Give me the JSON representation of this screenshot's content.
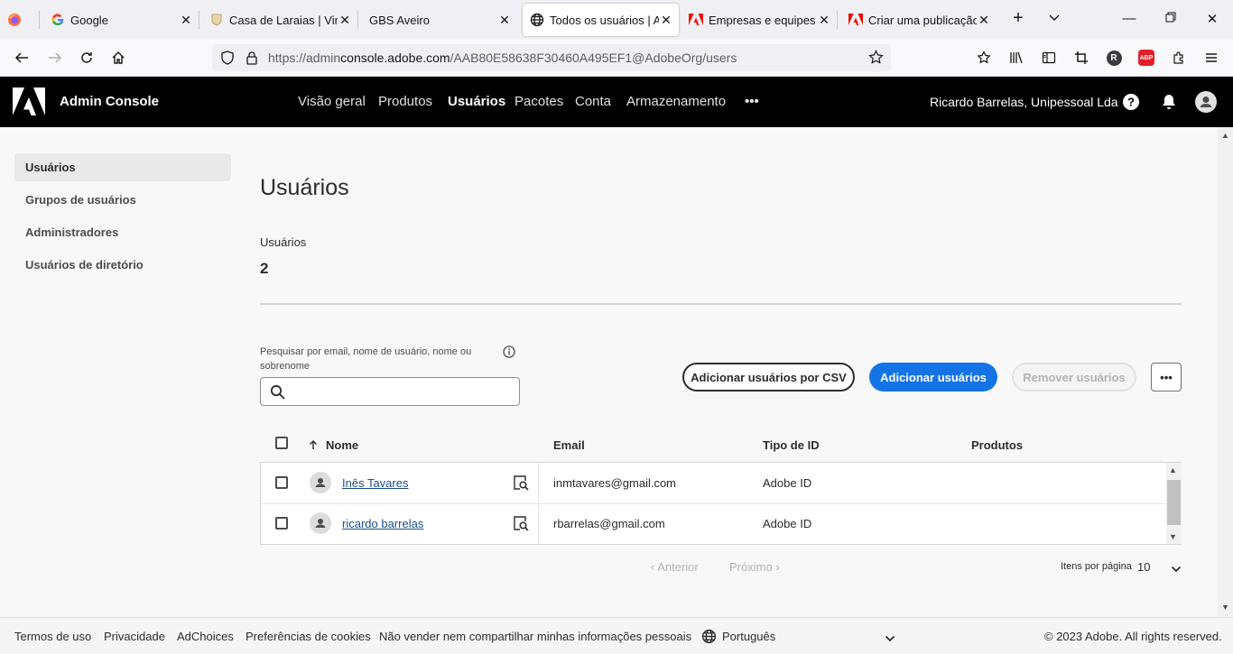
{
  "browser": {
    "tabs": [
      {
        "title": "",
        "icon": "firefox-icon"
      },
      {
        "title": "Google",
        "icon": "google-icon"
      },
      {
        "title": "Casa de Laraias | Vinho",
        "icon": "shield-crest-icon"
      },
      {
        "title": "GBS Aveiro",
        "icon": ""
      },
      {
        "title": "Todos os usuários | Ad",
        "icon": "globe-icon",
        "active": true
      },
      {
        "title": "Empresas e equipes | E",
        "icon": "adobe-icon"
      },
      {
        "title": "Criar uma publicação",
        "icon": "adobe-icon"
      }
    ],
    "url_prefix": "https://admin",
    "url_domain": "console.adobe.com",
    "url_suffix": "/AAB80E58638F30460A495EF1@AdobeOrg/users",
    "extension_badge": "R",
    "abp_badge": "ABP"
  },
  "header": {
    "app_title": "Admin Console",
    "nav": [
      {
        "label": "Visão geral"
      },
      {
        "label": "Produtos"
      },
      {
        "label": "Usuários",
        "active": true
      },
      {
        "label": "Pacotes"
      },
      {
        "label": "Conta"
      },
      {
        "label": "Armazenamento"
      },
      {
        "label": "•••"
      }
    ],
    "org_name": "Ricardo Barrelas, Unipessoal Lda"
  },
  "sidebar": {
    "items": [
      {
        "label": "Usuários",
        "active": true
      },
      {
        "label": "Grupos de usuários"
      },
      {
        "label": "Administradores"
      },
      {
        "label": "Usuários de diretório"
      }
    ]
  },
  "main": {
    "title": "Usuários",
    "stat_label": "Usuários",
    "stat_value": "2",
    "search_label": "Pesquisar por email, nome de usuário, nome ou sobrenome",
    "search_value": "",
    "buttons": {
      "csv": "Adicionar usuários por CSV",
      "add": "Adicionar usuários",
      "remove": "Remover usuários",
      "more": "•••"
    },
    "table": {
      "headers": {
        "name": "Nome",
        "email": "Email",
        "idtype": "Tipo de ID",
        "products": "Produtos"
      },
      "rows": [
        {
          "name": "Inês Tavares",
          "email": "inmtavares@gmail.com",
          "idtype": "Adobe ID",
          "products": ""
        },
        {
          "name": "ricardo barrelas",
          "email": "rbarrelas@gmail.com",
          "idtype": "Adobe ID",
          "products": ""
        }
      ]
    },
    "pagination": {
      "prev": "‹ Anterior",
      "next": "Próximo ›",
      "per_page_label": "Itens por página",
      "per_page_value": "10"
    }
  },
  "footer": {
    "links": [
      {
        "label": "Termos de uso"
      },
      {
        "label": "Privacidade"
      },
      {
        "label": "AdChoices"
      },
      {
        "label": "Preferências de cookies"
      },
      {
        "label": "Não vender nem compartilhar minhas informações pessoais"
      }
    ],
    "language": "Português",
    "copyright": "© 2023 Adobe. All rights reserved."
  },
  "colors": {
    "primary_button": "#1473e6",
    "header_bg": "#000000",
    "adobe_red": "#eb1000"
  }
}
